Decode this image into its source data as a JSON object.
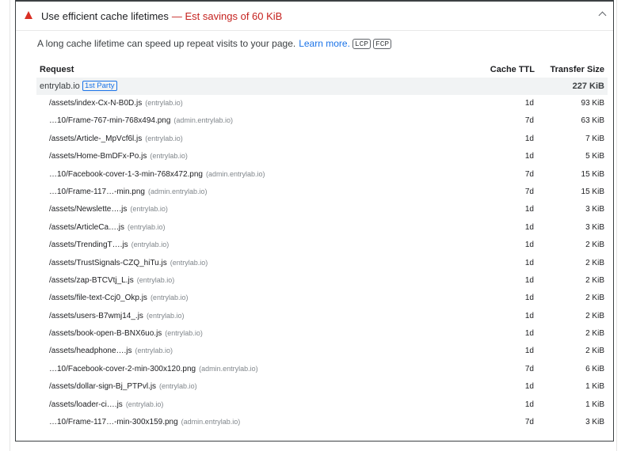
{
  "audit": {
    "title": "Use efficient cache lifetimes",
    "savings": "— Est savings of 60 KiB",
    "description": "A long cache lifetime can speed up repeat visits to your page.",
    "learn_more": "Learn more.",
    "badges": [
      "LCP",
      "FCP"
    ],
    "colors": {
      "warning": "#d93025",
      "savings": "#c5221f",
      "link": "#1a73e8"
    }
  },
  "table": {
    "headers": {
      "request": "Request",
      "cache_ttl": "Cache TTL",
      "transfer_size": "Transfer Size"
    },
    "group": {
      "name": "entrylab.io",
      "badge": "1st Party",
      "size": "227 KiB"
    },
    "rows": [
      {
        "url": "/assets/index-Cx-N-B0D.js",
        "host": "(entrylab.io)",
        "ttl": "1d",
        "size": "93 KiB"
      },
      {
        "url": "…10/Frame-767-min-768x494.png",
        "host": "(admin.entrylab.io)",
        "ttl": "7d",
        "size": "63 KiB"
      },
      {
        "url": "/assets/Article-_MpVcf6l.js",
        "host": "(entrylab.io)",
        "ttl": "1d",
        "size": "7 KiB"
      },
      {
        "url": "/assets/Home-BmDFx-Po.js",
        "host": "(entrylab.io)",
        "ttl": "1d",
        "size": "5 KiB"
      },
      {
        "url": "…10/Facebook-cover-1-3-min-768x472.png",
        "host": "(admin.entrylab.io)",
        "ttl": "7d",
        "size": "15 KiB"
      },
      {
        "url": "…10/Frame-117…-min.png",
        "host": "(admin.entrylab.io)",
        "ttl": "7d",
        "size": "15 KiB"
      },
      {
        "url": "/assets/Newslette….js",
        "host": "(entrylab.io)",
        "ttl": "1d",
        "size": "3 KiB"
      },
      {
        "url": "/assets/ArticleCa….js",
        "host": "(entrylab.io)",
        "ttl": "1d",
        "size": "3 KiB"
      },
      {
        "url": "/assets/TrendingT….js",
        "host": "(entrylab.io)",
        "ttl": "1d",
        "size": "2 KiB"
      },
      {
        "url": "/assets/TrustSignals-CZQ_hiTu.js",
        "host": "(entrylab.io)",
        "ttl": "1d",
        "size": "2 KiB"
      },
      {
        "url": "/assets/zap-BTCVtj_L.js",
        "host": "(entrylab.io)",
        "ttl": "1d",
        "size": "2 KiB"
      },
      {
        "url": "/assets/file-text-Ccj0_Okp.js",
        "host": "(entrylab.io)",
        "ttl": "1d",
        "size": "2 KiB"
      },
      {
        "url": "/assets/users-B7wmj14_.js",
        "host": "(entrylab.io)",
        "ttl": "1d",
        "size": "2 KiB"
      },
      {
        "url": "/assets/book-open-B-BNX6uo.js",
        "host": "(entrylab.io)",
        "ttl": "1d",
        "size": "2 KiB"
      },
      {
        "url": "/assets/headphone….js",
        "host": "(entrylab.io)",
        "ttl": "1d",
        "size": "2 KiB"
      },
      {
        "url": "…10/Facebook-cover-2-min-300x120.png",
        "host": "(admin.entrylab.io)",
        "ttl": "7d",
        "size": "6 KiB"
      },
      {
        "url": "/assets/dollar-sign-Bj_PTPvl.js",
        "host": "(entrylab.io)",
        "ttl": "1d",
        "size": "1 KiB"
      },
      {
        "url": "/assets/loader-ci….js",
        "host": "(entrylab.io)",
        "ttl": "1d",
        "size": "1 KiB"
      },
      {
        "url": "…10/Frame-117…-min-300x159.png",
        "host": "(admin.entrylab.io)",
        "ttl": "7d",
        "size": "3 KiB"
      }
    ]
  }
}
